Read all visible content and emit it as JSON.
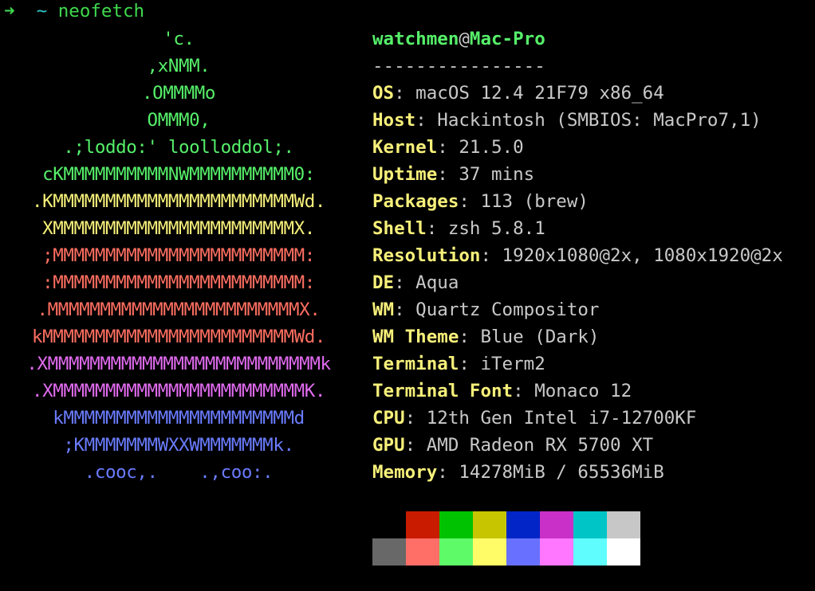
{
  "prompt": {
    "arrow": "➜",
    "tilde": "~",
    "command": "neofetch"
  },
  "logo": [
    {
      "text": "'c.",
      "color": "#56f06a"
    },
    {
      "text": ",xNMM.",
      "color": "#56f06a"
    },
    {
      "text": ".OMMMMo",
      "color": "#56f06a"
    },
    {
      "text": "OMMM0,",
      "color": "#56f06a"
    },
    {
      "text": ".;loddo:' loolloddol;.",
      "color": "#56f06a"
    },
    {
      "text": "cKMMMMMMMMMMNWMMMMMMMMMM0:",
      "color": "#56f06a"
    },
    {
      "text": ".KMMMMMMMMMMMMMMMMMMMMMMMWd.",
      "color": "#f7f07a"
    },
    {
      "text": "XMMMMMMMMMMMMMMMMMMMMMMMX.",
      "color": "#f7f07a"
    },
    {
      "text": ";MMMMMMMMMMMMMMMMMMMMMMMM:",
      "color": "#ff6f61"
    },
    {
      "text": ":MMMMMMMMMMMMMMMMMMMMMMMM:",
      "color": "#ff6f61"
    },
    {
      "text": ".MMMMMMMMMMMMMMMMMMMMMMMMX.",
      "color": "#ff6f61"
    },
    {
      "text": "kMMMMMMMMMMMMMMMMMMMMMMMMWd.",
      "color": "#ff6f61"
    },
    {
      "text": ".XMMMMMMMMMMMMMMMMMMMMMMMMMMk",
      "color": "#e26cf1"
    },
    {
      "text": ".XMMMMMMMMMMMMMMMMMMMMMMMMK.",
      "color": "#e26cf1"
    },
    {
      "text": "kMMMMMMMMMMMMMMMMMMMMMMd",
      "color": "#6a7cff"
    },
    {
      "text": ";KMMMMMMMWXXWMMMMMMMk.",
      "color": "#6a7cff"
    },
    {
      "text": ".cooc,.    .,coo:.",
      "color": "#6a7cff"
    }
  ],
  "info": {
    "user": "watchmen",
    "at": "@",
    "host": "Mac-Pro",
    "separator": "----------------",
    "fields": [
      {
        "key": "OS",
        "value": ": macOS 12.4 21F79 x86_64"
      },
      {
        "key": "Host",
        "value": ": Hackintosh (SMBIOS: MacPro7,1)"
      },
      {
        "key": "Kernel",
        "value": ": 21.5.0"
      },
      {
        "key": "Uptime",
        "value": ": 37 mins"
      },
      {
        "key": "Packages",
        "value": ": 113 (brew)"
      },
      {
        "key": "Shell",
        "value": ": zsh 5.8.1"
      },
      {
        "key": "Resolution",
        "value": ": 1920x1080@2x, 1080x1920@2x"
      },
      {
        "key": "DE",
        "value": ": Aqua"
      },
      {
        "key": "WM",
        "value": ": Quartz Compositor"
      },
      {
        "key": "WM Theme",
        "value": ": Blue (Dark)"
      },
      {
        "key": "Terminal",
        "value": ": iTerm2"
      },
      {
        "key": "Terminal Font",
        "value": ": Monaco 12"
      },
      {
        "key": "CPU",
        "value": ": 12th Gen Intel i7-12700KF"
      },
      {
        "key": "GPU",
        "value": ": AMD Radeon RX 5700 XT"
      },
      {
        "key": "Memory",
        "value": ": 14278MiB / 65536MiB"
      }
    ]
  },
  "palette": {
    "normal": [
      "#000000",
      "#c91b00",
      "#00c200",
      "#c7c400",
      "#0225c7",
      "#c930c7",
      "#00c5c7",
      "#c7c7c7"
    ],
    "bright": [
      "#686868",
      "#ff6e67",
      "#5ffa68",
      "#fffc67",
      "#6871ff",
      "#ff77ff",
      "#60fdff",
      "#ffffff"
    ]
  }
}
